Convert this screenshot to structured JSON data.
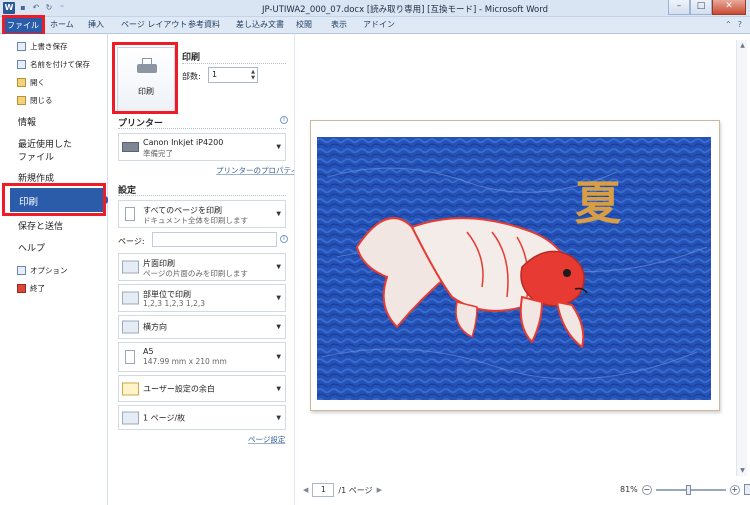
{
  "window": {
    "app_icon": "W",
    "title": "JP-UTIWA2_000_07.docx [読み取り専用] [互換モード] - Microsoft Word"
  },
  "ribbon_tabs": [
    "ファイル",
    "ホーム",
    "挿入",
    "ページ レイアウト",
    "参考資料",
    "差し込み文書",
    "校閲",
    "表示",
    "アドイン"
  ],
  "backstage_nav": {
    "save": "上書き保存",
    "save_as": "名前を付けて保存",
    "open": "開く",
    "close": "閉じる",
    "info": "情報",
    "recent_line1": "最近使用した",
    "recent_line2": "ファイル",
    "new": "新規作成",
    "print": "印刷",
    "save_send": "保存と送信",
    "help": "ヘルプ",
    "options": "オプション",
    "exit": "終了"
  },
  "print_panel": {
    "section_title": "印刷",
    "print_button_label": "印刷",
    "copies_label": "部数:",
    "copies_value": "1",
    "printer_title": "プリンター",
    "printer_name": "Canon Inkjet iP4200",
    "printer_status": "準備完了",
    "printer_props_link": "プリンターのプロパティ",
    "settings_title": "設定",
    "print_all_title": "すべてのページを印刷",
    "print_all_sub": "ドキュメント全体を印刷します",
    "pages_label": "ページ:",
    "one_side_title": "片面印刷",
    "one_side_sub": "ページの片面のみを印刷します",
    "collate_title": "部単位で印刷",
    "collate_sub": "1,2,3    1,2,3    1,2,3",
    "orientation": "横方向",
    "paper_title": "A5",
    "paper_sub": "147.99 mm x 210 mm",
    "margins": "ユーザー設定の余白",
    "pages_per_sheet": "1 ページ/枚",
    "page_setup_link": "ページ設定"
  },
  "preview": {
    "kanji": "夏",
    "current_page": "1",
    "page_total": "/1 ページ",
    "zoom_level": "81%"
  },
  "colors": {
    "accent": "#2a5caa",
    "highlight": "#ee1c24",
    "water": "#2552b8",
    "kanji": "#e2a33f",
    "fish": "#e63a32"
  }
}
